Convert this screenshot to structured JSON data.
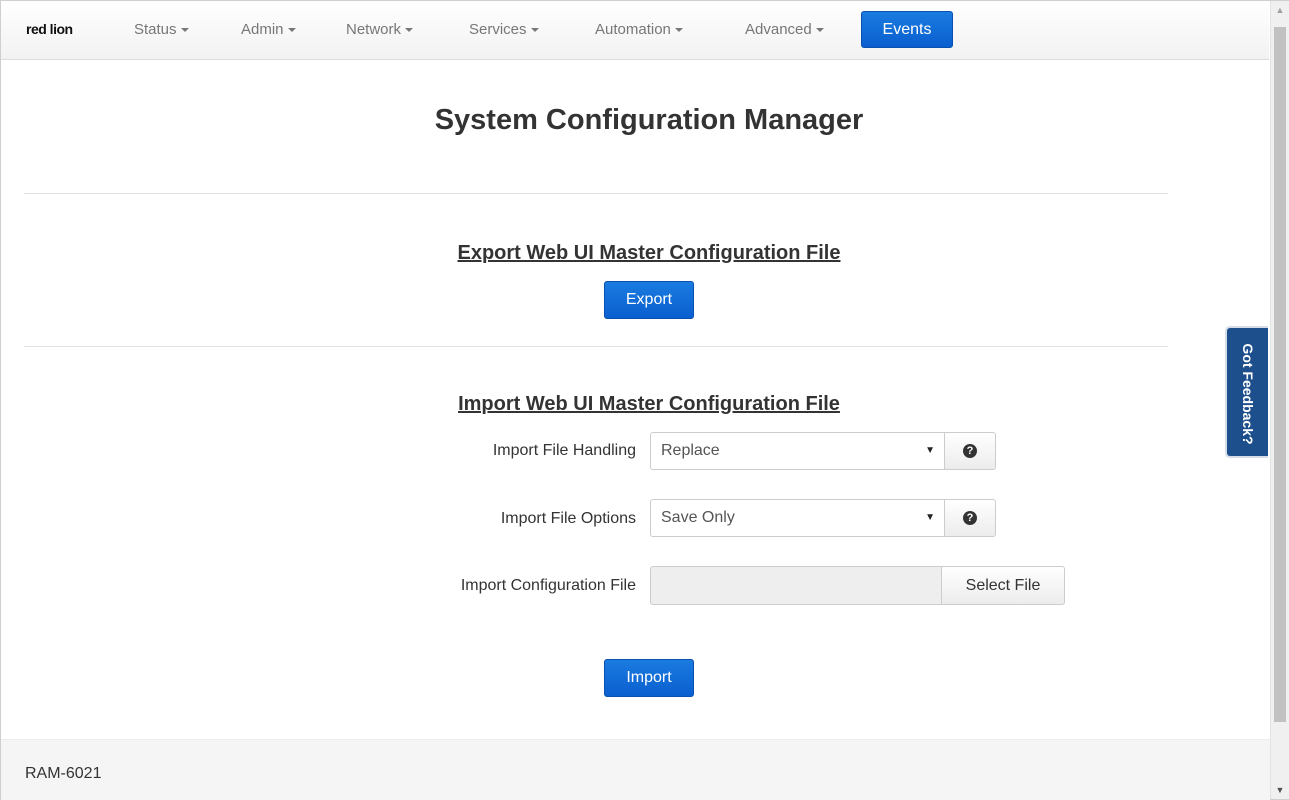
{
  "nav": {
    "brand": "red lion",
    "items": [
      {
        "label": "Status"
      },
      {
        "label": "Admin"
      },
      {
        "label": "Network"
      },
      {
        "label": "Services"
      },
      {
        "label": "Automation"
      },
      {
        "label": "Advanced"
      }
    ],
    "active": "Events"
  },
  "page": {
    "title": "System Configuration Manager"
  },
  "export_section": {
    "title": "Export Web UI Master Configuration File",
    "button": "Export"
  },
  "import_section": {
    "title": "Import Web UI Master Configuration File",
    "handling_label": "Import File Handling",
    "handling_value": "Replace",
    "options_label": "Import File Options",
    "options_value": "Save Only",
    "file_label": "Import Configuration File",
    "file_value": "",
    "select_file_button": "Select File",
    "import_button": "Import"
  },
  "feedback": {
    "label": "Got Feedback?"
  },
  "footer": {
    "device": "RAM-6021"
  },
  "colors": {
    "primary": "#0a5fcf",
    "feedback": "#1d4f8c",
    "brand_accent": "#c8102e"
  },
  "icons": {
    "help": "question-circle-icon",
    "dropdown": "caret-down-icon"
  }
}
